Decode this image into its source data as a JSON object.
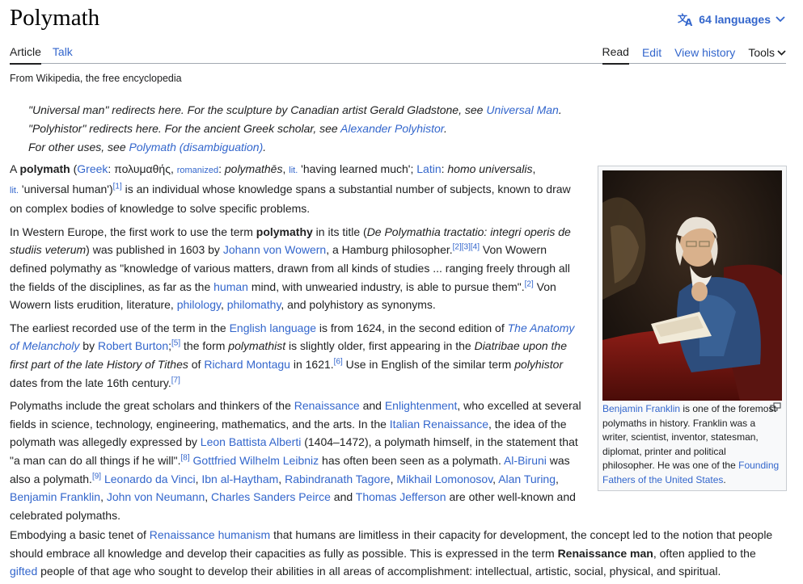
{
  "page": {
    "title": "Polymath",
    "languages_label": "64 languages",
    "from": "From Wikipedia, the free encyclopedia"
  },
  "tabs": {
    "article": "Article",
    "talk": "Talk",
    "read": "Read",
    "edit": "Edit",
    "history": "View history",
    "tools": "Tools"
  },
  "hatnotes": {
    "h1_pre": "\"Universal man\" redirects here. For the sculpture by Canadian artist Gerald Gladstone, see ",
    "h1_link": "Universal Man",
    "h1_post": ".",
    "h2_pre": "\"Polyhistor\" redirects here. For the ancient Greek scholar, see ",
    "h2_link": "Alexander Polyhistor",
    "h2_post": ".",
    "h3_pre": "For other uses, see ",
    "h3_link": "Polymath (disambiguation)",
    "h3_post": "."
  },
  "p1": {
    "a": "A ",
    "b": "polymath",
    "c": " (",
    "greek": "Greek",
    "d": ": πολυμαθής, ",
    "romanized": "romanized",
    "e": ": ",
    "f": "polymathēs",
    "g": ", ",
    "lit1": "lit.",
    "h": " 'having learned much'; ",
    "latin": "Latin",
    "i": ": ",
    "j": "homo universalis",
    "k": ",",
    "lit2": "lit.",
    "l": " 'universal human')",
    "r1": "[1]",
    "m": " is an individual whose knowledge spans a substantial number of subjects, known to draw on complex bodies of knowledge to solve specific problems."
  },
  "p2": {
    "a": "In Western Europe, the first work to use the term ",
    "b": "polymathy",
    "c": " in its title (",
    "d": "De Polymathia tractatio: integri operis de studiis veterum",
    "e": ") was published in 1603 by ",
    "wowern": "Johann von Wowern",
    "f": ", a Hamburg philosopher.",
    "r234": "[2][3][4]",
    "g": " Von Wowern defined polymathy as \"knowledge of various matters, drawn from all kinds of studies ... ranging freely through all the fields of the disciplines, as far as the ",
    "human": "human",
    "h": " mind, with unwearied industry, is able to pursue them\".",
    "r2": "[2]",
    "i": " Von Wowern lists erudition, literature, ",
    "philology": "philology",
    "j": ", ",
    "philomathy": "philomathy",
    "k": ", and polyhistory as synonyms."
  },
  "p3": {
    "a": "The earliest recorded use of the term in the ",
    "english": "English language",
    "b": " is from 1624, in the second edition of ",
    "anatomy": "The Anatomy of Melancholy",
    "c": " by ",
    "burton": "Robert Burton",
    "d": ";",
    "r5": "[5]",
    "e": " the form ",
    "f": "polymathist",
    "g": " is slightly older, first appearing in the ",
    "h": "Diatribae upon the first part of the late History of Tithes",
    "i": " of ",
    "montagu": "Richard Montagu",
    "j": " in 1621.",
    "r6": "[6]",
    "k": " Use in English of the similar term ",
    "l": "polyhistor",
    "m": " dates from the late 16th century.",
    "r7": "[7]"
  },
  "p4": {
    "a": "Polymaths include the great scholars and thinkers of the ",
    "renaissance": "Renaissance",
    "b": " and ",
    "enlightenment": "Enlightenment",
    "c": ", who excelled at several fields in science, technology, engineering, mathematics, and the arts. In the ",
    "italian": "Italian Renaissance",
    "d": ", the idea of the polymath was allegedly expressed by ",
    "alberti": "Leon Battista Alberti",
    "e": " (1404–1472), a polymath himself, in the statement that \"a man can do all things if he will\".",
    "r8": "[8]",
    "f": " ",
    "leibniz": "Gottfried Wilhelm Leibniz",
    "g": " has often been seen as a polymath. ",
    "biruni": "Al-Biruni",
    "h": " was also a polymath.",
    "r9": "[9]",
    "i": " ",
    "davinci": "Leonardo da Vinci",
    "j": ", ",
    "haytham": "Ibn al-Haytham",
    "k": ", ",
    "tagore": "Rabindranath Tagore",
    "l": ", ",
    "lomonosov": "Mikhail Lomonosov",
    "m": ", ",
    "turing": "Alan Turing",
    "n": ", ",
    "franklin": "Benjamin Franklin",
    "o": ", ",
    "neumann": "John von Neumann",
    "p": ", ",
    "peirce": "Charles Sanders Peirce",
    "q": " and ",
    "jefferson": "Thomas Jefferson",
    "r": " are other well-known and celebrated polymaths."
  },
  "p5": {
    "a": "Embodying a basic tenet of ",
    "humanism": "Renaissance humanism",
    "b": " that humans are limitless in their capacity for development, the concept led to the notion that people should embrace all knowledge and develop their capacities as fully as possible. This is expressed in the term ",
    "c": "Renaissance man",
    "d": ", often applied to the ",
    "gifted": "gifted",
    "e": " people of that age who sought to develop their abilities in all areas of accomplishment: intellectual, artistic, social, physical, and spiritual."
  },
  "infobox": {
    "caption_link": "Benjamin Franklin",
    "caption_text": " is one of the foremost polymaths in history. Franklin was a writer, scientist, inventor, statesman, diplomat, printer and political philosopher. He was one of the ",
    "caption_link2": "Founding Fathers of the United States",
    "caption_end": "."
  },
  "colors": {
    "link": "#3366cc",
    "text": "#202122",
    "border": "#a2a9b1"
  }
}
